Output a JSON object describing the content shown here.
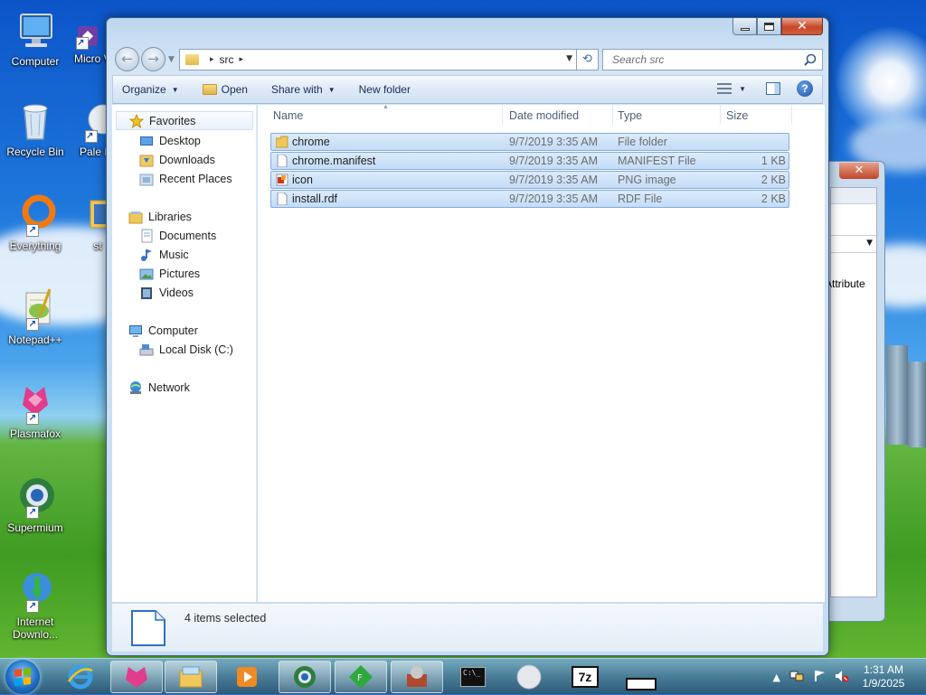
{
  "desktop": {
    "icons": [
      {
        "label": "Computer"
      },
      {
        "label": "Micro Visual"
      },
      {
        "label": "Recycle Bin"
      },
      {
        "label": "Pale M"
      },
      {
        "label": "Everything"
      },
      {
        "label": "st"
      },
      {
        "label": "Notepad++"
      },
      {
        "label": "Plasmafox"
      },
      {
        "label": "Supermium"
      },
      {
        "label": "Internet Downlo..."
      }
    ]
  },
  "background_window": {
    "close_glyph": "✕",
    "column_label": "Attribute"
  },
  "explorer": {
    "address": {
      "crumbs": [
        "src"
      ],
      "separator": "▸"
    },
    "search": {
      "placeholder": "Search src"
    },
    "toolbar": {
      "organize": "Organize",
      "open": "Open",
      "share_with": "Share with",
      "new_folder": "New folder"
    },
    "nav": {
      "favorites": "Favorites",
      "desktop": "Desktop",
      "downloads": "Downloads",
      "recent_places": "Recent Places",
      "libraries": "Libraries",
      "documents": "Documents",
      "music": "Music",
      "pictures": "Pictures",
      "videos": "Videos",
      "computer": "Computer",
      "local_disk": "Local Disk (C:)",
      "network": "Network"
    },
    "columns": {
      "name": "Name",
      "date_modified": "Date modified",
      "type": "Type",
      "size": "Size"
    },
    "files": [
      {
        "name": "chrome",
        "date": "9/7/2019 3:35 AM",
        "type": "File folder",
        "size": "",
        "icon": "folder-icon"
      },
      {
        "name": "chrome.manifest",
        "date": "9/7/2019 3:35 AM",
        "type": "MANIFEST File",
        "size": "1 KB",
        "icon": "file-icon"
      },
      {
        "name": "icon",
        "date": "9/7/2019 3:35 AM",
        "type": "PNG image",
        "size": "2 KB",
        "icon": "image-icon"
      },
      {
        "name": "install.rdf",
        "date": "9/7/2019 3:35 AM",
        "type": "RDF File",
        "size": "2 KB",
        "icon": "file-icon"
      }
    ],
    "status": {
      "selection": "4 items selected"
    }
  },
  "taskbar": {
    "clock": {
      "time": "1:31 AM",
      "date": "1/9/2025"
    },
    "cmd_label": "C:\\_",
    "zip_label": "7z"
  },
  "colors": {
    "selection_bg": "#cce4fa",
    "selection_border": "#84acdd",
    "link_text": "#1e3287"
  }
}
